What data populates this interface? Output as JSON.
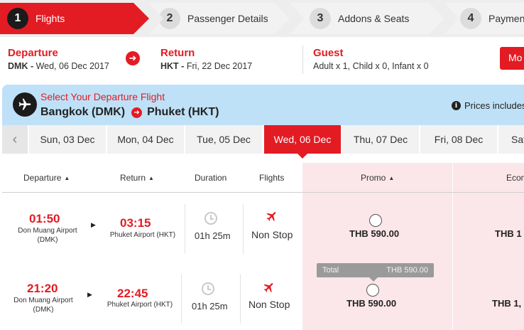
{
  "steps": [
    {
      "num": "1",
      "label": "Flights"
    },
    {
      "num": "2",
      "label": "Passenger Details"
    },
    {
      "num": "3",
      "label": "Addons & Seats"
    },
    {
      "num": "4",
      "label": "Payment"
    }
  ],
  "summary": {
    "departure_title": "Departure",
    "departure_code": "DMK - ",
    "departure_date": "Wed, 06 Dec 2017",
    "return_title": "Return",
    "return_code": "HKT - ",
    "return_date": "Fri, 22 Dec 2017",
    "guest_title": "Guest",
    "guest_detail": "Adult x 1, Child x 0, Infant x 0",
    "modify_label": "Mo"
  },
  "banner": {
    "subtitle": "Select Your Departure Flight",
    "origin": "Bangkok (DMK)",
    "destination": "Phuket (HKT)",
    "price_note": "Prices includes"
  },
  "dates": [
    {
      "label": "Sun, 03 Dec"
    },
    {
      "label": "Mon, 04 Dec"
    },
    {
      "label": "Tue, 05 Dec"
    },
    {
      "label": "Wed, 06 Dec"
    },
    {
      "label": "Thu, 07 Dec"
    },
    {
      "label": "Fri, 08 Dec"
    },
    {
      "label": "Sat"
    }
  ],
  "columns": {
    "departure": "Departure",
    "return": "Return",
    "duration": "Duration",
    "flights": "Flights",
    "promo": "Promo",
    "economy": "Econ"
  },
  "flights": [
    {
      "dep_time": "01:50",
      "dep_airport_1": "Don Muang Airport",
      "dep_airport_2": "(DMK)",
      "arr_time": "03:15",
      "arr_airport": "Phuket Airport (HKT)",
      "duration": "01h 25m",
      "stops": "Non Stop",
      "promo_fare": "THB 590.00",
      "economy_fare": "THB 1"
    },
    {
      "dep_time": "21:20",
      "dep_airport_1": "Don Muang Airport",
      "dep_airport_2": "(DMK)",
      "arr_time": "22:45",
      "arr_airport": "Phuket Airport (HKT)",
      "duration": "01h 25m",
      "stops": "Non Stop",
      "promo_fare": "THB 590.00",
      "economy_fare": "THB 1,"
    }
  ],
  "tooltip": {
    "label": "Total",
    "value": "THB 590.00"
  },
  "colors": {
    "accent": "#e31b23",
    "banner": "#bfe1f7",
    "fare_column": "#fbe6ea"
  }
}
